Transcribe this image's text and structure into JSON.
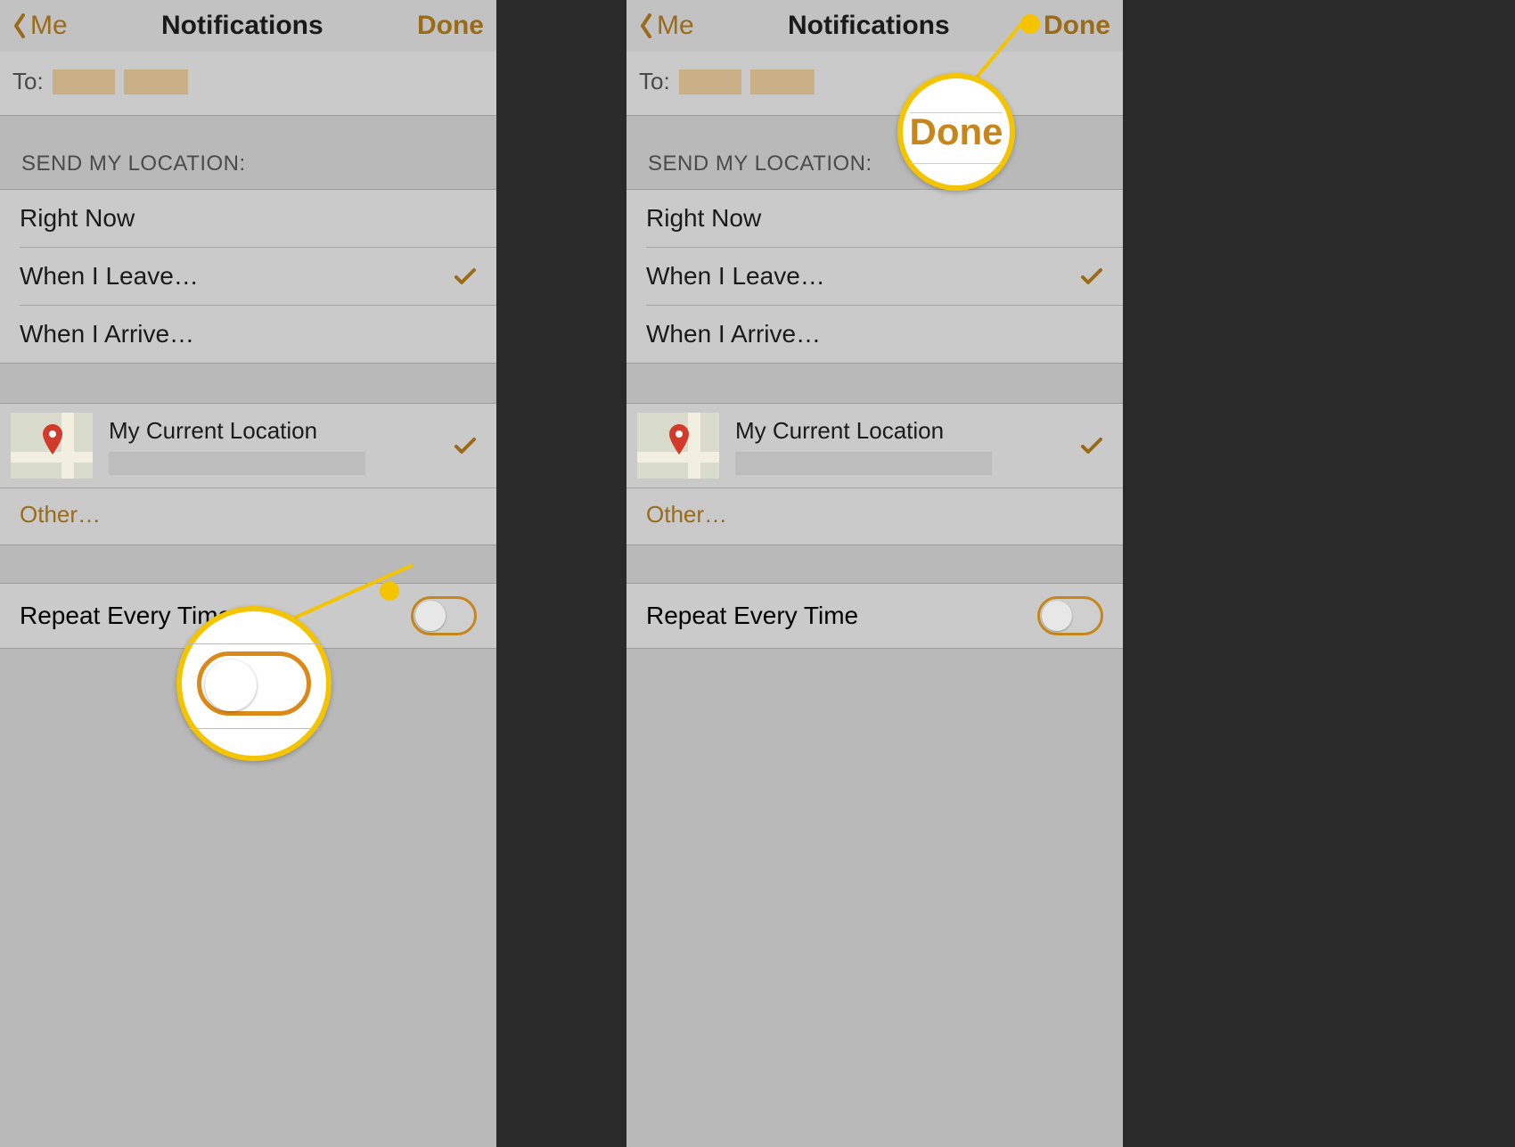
{
  "nav": {
    "back_label": "Me",
    "title": "Notifications",
    "done_label": "Done"
  },
  "to": {
    "label": "To:"
  },
  "send_section": {
    "header": "SEND MY LOCATION:",
    "options": [
      {
        "label": "Right Now",
        "selected": false
      },
      {
        "label": "When I Leave…",
        "selected": true
      },
      {
        "label": "When I Arrive…",
        "selected": false
      }
    ]
  },
  "location": {
    "title": "My Current Location",
    "selected": true,
    "other_label": "Other…"
  },
  "repeat": {
    "label": "Repeat Every Time",
    "on": false
  },
  "callout_done": "Done"
}
